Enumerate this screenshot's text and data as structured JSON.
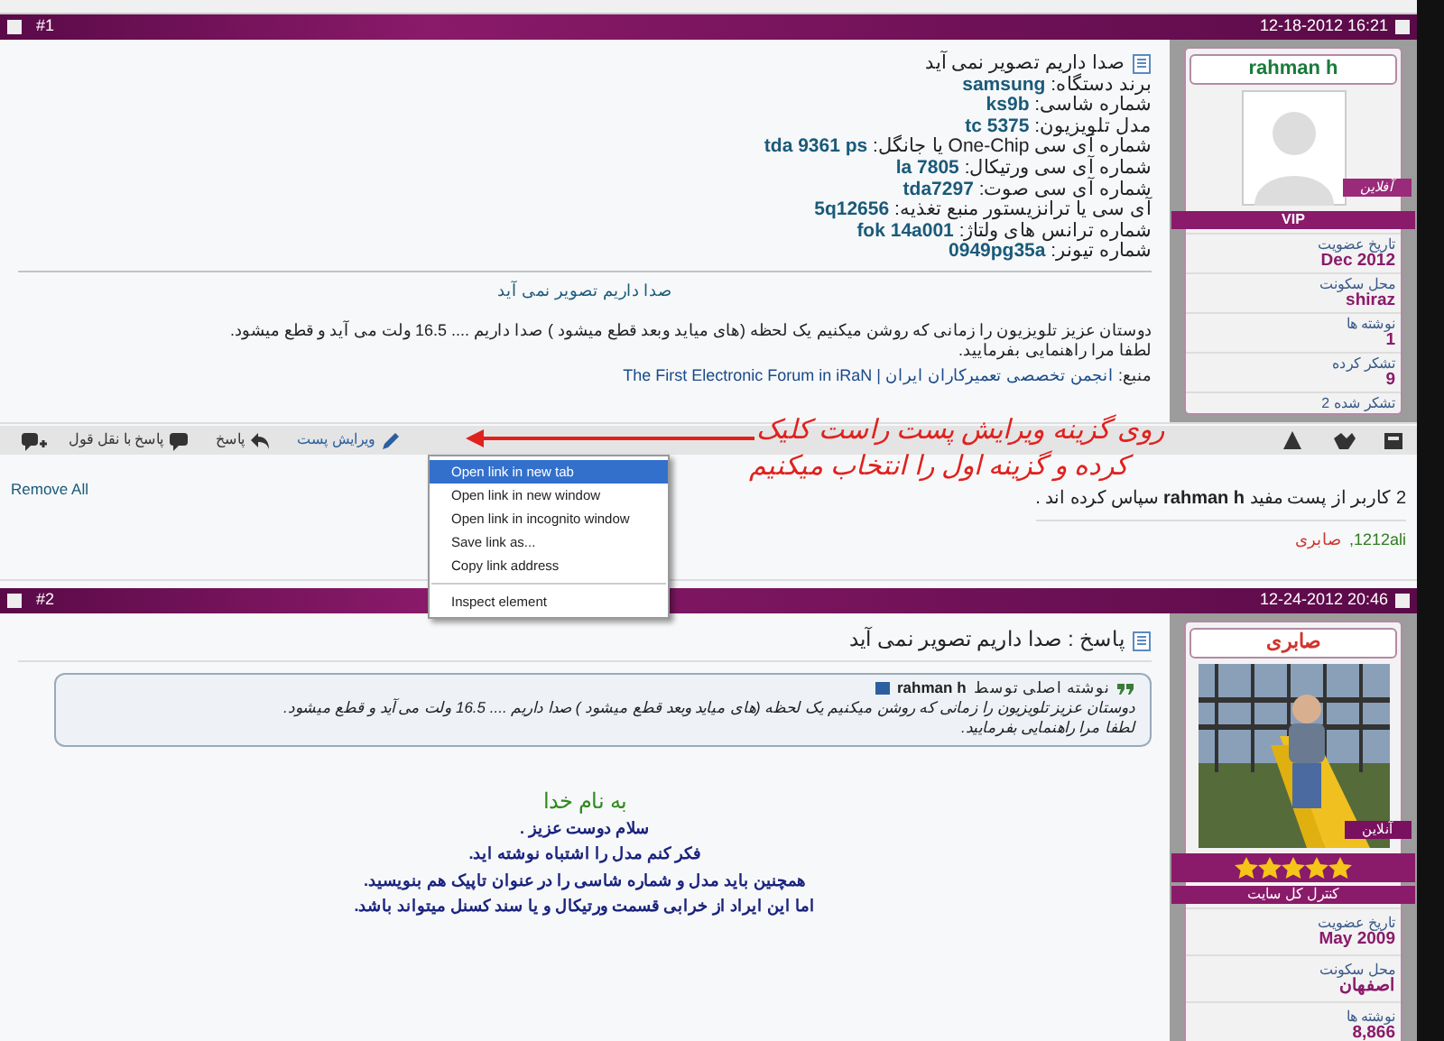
{
  "posts": [
    {
      "number": "#1",
      "checked": false,
      "date": "12-18-2012 16:21",
      "user": {
        "name": "rahman h",
        "color": "#1a7a3a",
        "status": "آفلاین",
        "online": false,
        "title": "VIP",
        "avatar": {
          "kind": "default"
        },
        "stats": [
          {
            "label": "تاریخ عضویت",
            "value": "Dec 2012"
          },
          {
            "label": "محل سکونت",
            "value": "shiraz"
          },
          {
            "label": "نوشته ها",
            "value": "1"
          },
          {
            "label": "تشکر کرده",
            "value": "9"
          },
          {
            "label": "تشکر شده",
            "value": "2",
            "kind": "inline"
          }
        ]
      },
      "title": "صدا داریم تصویر نمی آید",
      "fields": [
        {
          "label": "برند دستگاه:",
          "value": "samsung"
        },
        {
          "label": "شماره شاسی:",
          "value": "ks9b"
        },
        {
          "label": "مدل تلویزیون:",
          "value": "tc 5375"
        },
        {
          "label": "شماره آی سی One-Chip یا جانگل:",
          "value": "tda 9361 ps"
        },
        {
          "label": "شماره آی سی ورتیکال:",
          "value": "la 7805"
        },
        {
          "label": "شماره آی سی صوت:",
          "value": "tda7297"
        },
        {
          "label": "آی سی یا ترانزیستور منبع تغذیه:",
          "value": "5q12656"
        },
        {
          "label": "شماره ترانس های ولتاژ:",
          "value": "fok 14a001"
        },
        {
          "label": "شماره تیونر:",
          "value": "0949pg35a"
        }
      ],
      "subtitle": "صدا داریم تصویر نمی آید",
      "paragraphs": [
        "دوستان عزیز تلویزیون را زمانی که روشن میکنیم یک لحظه (های میاید وبعد قطع میشود ) صدا داریم .... 16.5 ولت می آید و قطع میشود.",
        "لطفا مرا راهنمایی بفرمایید."
      ],
      "source": {
        "label": "منبع:",
        "link": "انجمن تخصصی تعمیرکاران ایران | The First Electronic Forum in iRaN"
      },
      "toolbar": {
        "left": [
          {
            "kind": "edit",
            "label": "ویرایش پست"
          },
          {
            "kind": "reply",
            "label": "پاسخ"
          },
          {
            "kind": "quote",
            "label": "پاسخ با نقل قول"
          },
          {
            "kind": "multiquote"
          }
        ],
        "right": [
          {
            "kind": "ip"
          },
          {
            "kind": "thanks"
          },
          {
            "kind": "report"
          }
        ]
      },
      "thanks": {
        "remove": "Remove All",
        "text": "2 کاربر از پست مفید **rahman h** سپاس کرده اند .",
        "users": [
          {
            "name": "1212ali,",
            "color": "#2e7d1e"
          },
          {
            "name": "صابری",
            "color": "#d0342c"
          }
        ]
      }
    },
    {
      "number": "#2",
      "checked": false,
      "date": "12-24-2012 20:46",
      "user": {
        "name": "صابری",
        "color": "#d0342c",
        "status": "آنلاین",
        "online": true,
        "title": "کنترل کل سایت",
        "stars": 5,
        "stats": [
          {
            "label": "تاریخ عضویت",
            "value": "May 2009"
          },
          {
            "label": "محل سکونت",
            "value": "اصفهان"
          },
          {
            "label": "نوشته ها",
            "value": "8,866"
          }
        ]
      },
      "title": "پاسخ : صدا داریم تصویر نمی آید",
      "quote": {
        "intro": "نوشته اصلی توسط",
        "author": "rahman h",
        "lines": [
          "دوستان عزیز تلویزیون را زمانی که روشن میکنیم یک لحظه (های میاید وبعد قطع میشود ) صدا داریم .... 16.5 ولت می آید و قطع میشود.",
          "لطفا مرا راهنمایی بفرمایید."
        ]
      },
      "greeting": "به نام خدا",
      "body": [
        "سلام دوست عزیز .",
        "فکر کنم مدل را اشتباه نوشته اید.",
        "همچنین باید مدل و شماره شاسی را در عنوان تاپیک هم بنویسید.",
        "اما این ایراد از خرابی قسمت ورتیکال و یا سند کسنل میتواند باشد."
      ]
    }
  ],
  "context_menu": {
    "items": [
      {
        "label": "Open link in new tab",
        "selected": true
      },
      {
        "label": "Open link in new window",
        "selected": false
      },
      {
        "label": "Open link in incognito window",
        "selected": false
      },
      {
        "label": "Save link as...",
        "selected": false
      },
      {
        "label": "Copy link address",
        "selected": false
      },
      {
        "label": "Inspect element",
        "selected": false,
        "separator": true
      }
    ]
  },
  "annotation": {
    "lines": [
      "روی گزینه ویرایش پست راست کلیک",
      "کرده و گزینه اول را انتخاب میکنیم"
    ]
  }
}
